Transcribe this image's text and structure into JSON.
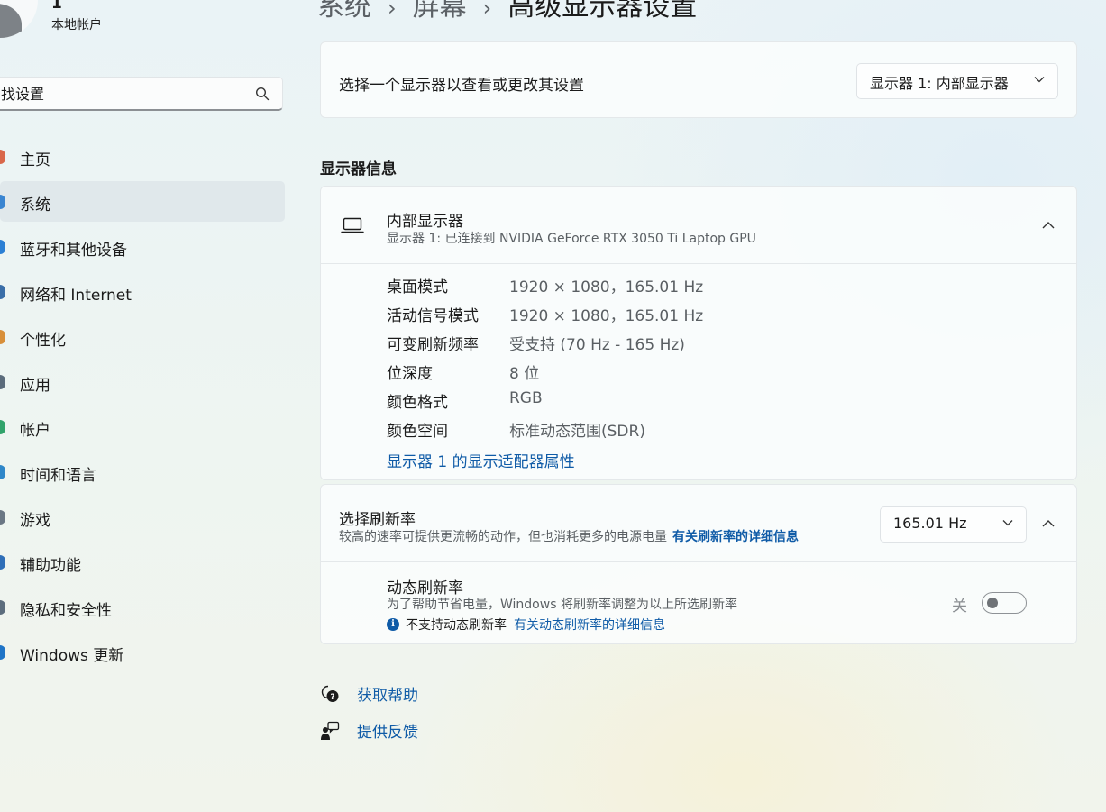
{
  "user": {
    "name": "1",
    "account": "本地帐户"
  },
  "search": {
    "placeholder": "找设置"
  },
  "sidebar": {
    "items": [
      {
        "label": "主页",
        "icon": "home-icon",
        "color": "#d9674a"
      },
      {
        "label": "系统",
        "icon": "system-icon",
        "color": "#3a85d1"
      },
      {
        "label": "蓝牙和其他设备",
        "icon": "bluetooth-icon",
        "color": "#2b7fd4"
      },
      {
        "label": "网络和 Internet",
        "icon": "network-icon",
        "color": "#3a6ea8"
      },
      {
        "label": "个性化",
        "icon": "personalization-icon",
        "color": "#d88f3a"
      },
      {
        "label": "应用",
        "icon": "apps-icon",
        "color": "#5b6c7c"
      },
      {
        "label": "帐户",
        "icon": "accounts-icon",
        "color": "#31a36b"
      },
      {
        "label": "时间和语言",
        "icon": "time-language-icon",
        "color": "#2f87c9"
      },
      {
        "label": "游戏",
        "icon": "gaming-icon",
        "color": "#6a7784"
      },
      {
        "label": "辅助功能",
        "icon": "accessibility-icon",
        "color": "#2f6fb8"
      },
      {
        "label": "隐私和安全性",
        "icon": "privacy-icon",
        "color": "#5c6d7d"
      },
      {
        "label": "Windows 更新",
        "icon": "windows-update-icon",
        "color": "#1f74c7"
      }
    ],
    "selected_index": 1
  },
  "breadcrumb": {
    "items": [
      "系统",
      "屏幕"
    ],
    "current": "高级显示器设置"
  },
  "display_select": {
    "label": "选择一个显示器以查看或更改其设置",
    "value": "显示器 1: 内部显示器"
  },
  "display_info": {
    "section_title": "显示器信息",
    "name": "内部显示器",
    "subtitle": "显示器 1: 已连接到 NVIDIA GeForce RTX 3050 Ti Laptop GPU",
    "rows": [
      {
        "key": "桌面模式",
        "value": "1920 × 1080，165.01 Hz"
      },
      {
        "key": "活动信号模式",
        "value": "1920 × 1080，165.01 Hz"
      },
      {
        "key": "可变刷新频率",
        "value": "受支持 (70 Hz - 165 Hz)"
      },
      {
        "key": "位深度",
        "value": "8 位"
      },
      {
        "key": "颜色格式",
        "value": "RGB"
      },
      {
        "key": "颜色空间",
        "value": "标准动态范围(SDR)"
      }
    ],
    "adapter_link": "显示器 1 的显示适配器属性"
  },
  "refresh_rate": {
    "title": "选择刷新率",
    "description": "较高的速率可提供更流畅的动作，但也消耗更多的电源电量",
    "link": "有关刷新率的详细信息",
    "value": "165.01 Hz",
    "dynamic": {
      "title": "动态刷新率",
      "description": "为了帮助节省电量，Windows 将刷新率调整为以上所选刷新率",
      "note": "不支持动态刷新率",
      "note_link": "有关动态刷新率的详细信息",
      "toggle_label": "关",
      "toggle_on": false
    }
  },
  "help": {
    "get_help": "获取帮助",
    "feedback": "提供反馈"
  },
  "colors": {
    "accent": "#0f5ba7",
    "link": "#0f5ba7"
  }
}
